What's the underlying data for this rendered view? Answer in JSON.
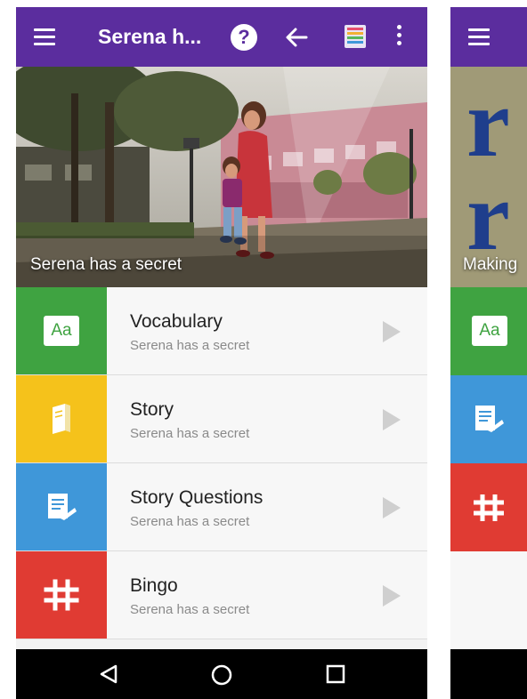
{
  "appbar": {
    "title": "Serena h...",
    "icons": [
      "menu-icon",
      "help-icon",
      "back-arrow-icon",
      "color-strip-icon",
      "overflow-menu-icon"
    ],
    "help_glyph": "?",
    "color": "#5b2d9e"
  },
  "hero": {
    "caption": "Serena has a secret"
  },
  "menu_items": [
    {
      "title": "Vocabulary",
      "subtitle": "Serena has a secret",
      "color": "#3fa341",
      "icon": "aa-icon",
      "icon_text": "Aa"
    },
    {
      "title": "Story",
      "subtitle": "Serena has a secret",
      "color": "#f5c21b",
      "icon": "book-icon"
    },
    {
      "title": "Story Questions",
      "subtitle": "Serena has a secret",
      "color": "#3f97d9",
      "icon": "questions-icon"
    },
    {
      "title": "Bingo",
      "subtitle": "Serena has a secret",
      "color": "#e03b33",
      "icon": "bingo-icon"
    }
  ],
  "navbar": {
    "icons": [
      "nav-back-icon",
      "nav-home-icon",
      "nav-recents-icon"
    ]
  },
  "peek_screen": {
    "hero_caption": "Making",
    "tile_colors": [
      "#3fa341",
      "#3f97d9",
      "#e03b33"
    ],
    "aa_text": "Aa"
  }
}
